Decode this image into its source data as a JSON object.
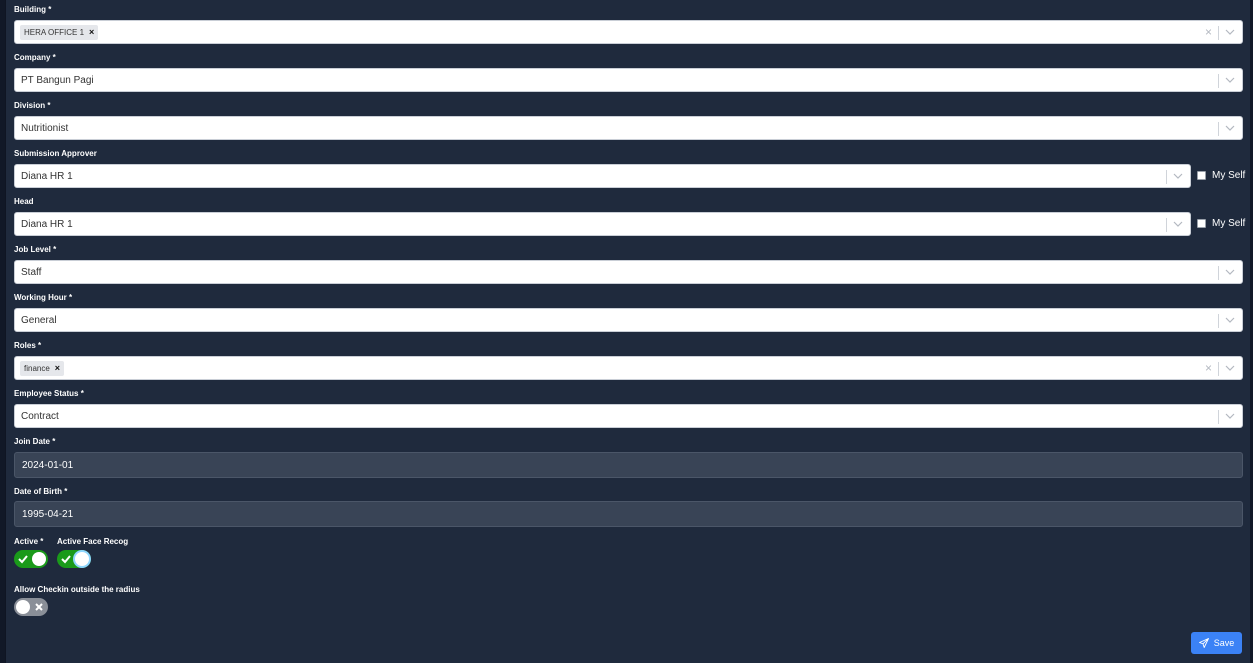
{
  "form": {
    "building": {
      "label": "Building *",
      "tags": [
        "HERA OFFICE 1"
      ]
    },
    "company": {
      "label": "Company *",
      "value": "PT Bangun Pagi"
    },
    "division": {
      "label": "Division *",
      "value": "Nutritionist"
    },
    "submission_approver": {
      "label": "Submission Approver",
      "value": "Diana HR 1",
      "myself_label": "My Self"
    },
    "head": {
      "label": "Head",
      "value": "Diana HR 1",
      "myself_label": "My Self"
    },
    "job_level": {
      "label": "Job Level *",
      "value": "Staff"
    },
    "working_hour": {
      "label": "Working Hour *",
      "value": "General"
    },
    "roles": {
      "label": "Roles *",
      "tags": [
        "finance"
      ]
    },
    "employee_status": {
      "label": "Employee Status *",
      "value": "Contract"
    },
    "join_date": {
      "label": "Join Date *",
      "value": "2024-01-01"
    },
    "date_of_birth": {
      "label": "Date of Birth *",
      "value": "1995-04-21"
    },
    "active": {
      "label": "Active *",
      "on": true
    },
    "active_face_recog": {
      "label": "Active Face Recog",
      "on": true
    },
    "allow_checkin": {
      "label": "Allow Checkin outside the radius",
      "on": false
    },
    "save_label": "Save"
  },
  "icons": {
    "clear": "×",
    "tag_remove": "×",
    "dropdown": "chevron-down-icon",
    "check": "check-icon",
    "cross": "x-icon",
    "send": "send-icon"
  },
  "colors": {
    "background": "#1f2a3d",
    "toggle_on": "#1a9a1a",
    "toggle_off": "#8a8f98",
    "save_button": "#3b82f6"
  }
}
